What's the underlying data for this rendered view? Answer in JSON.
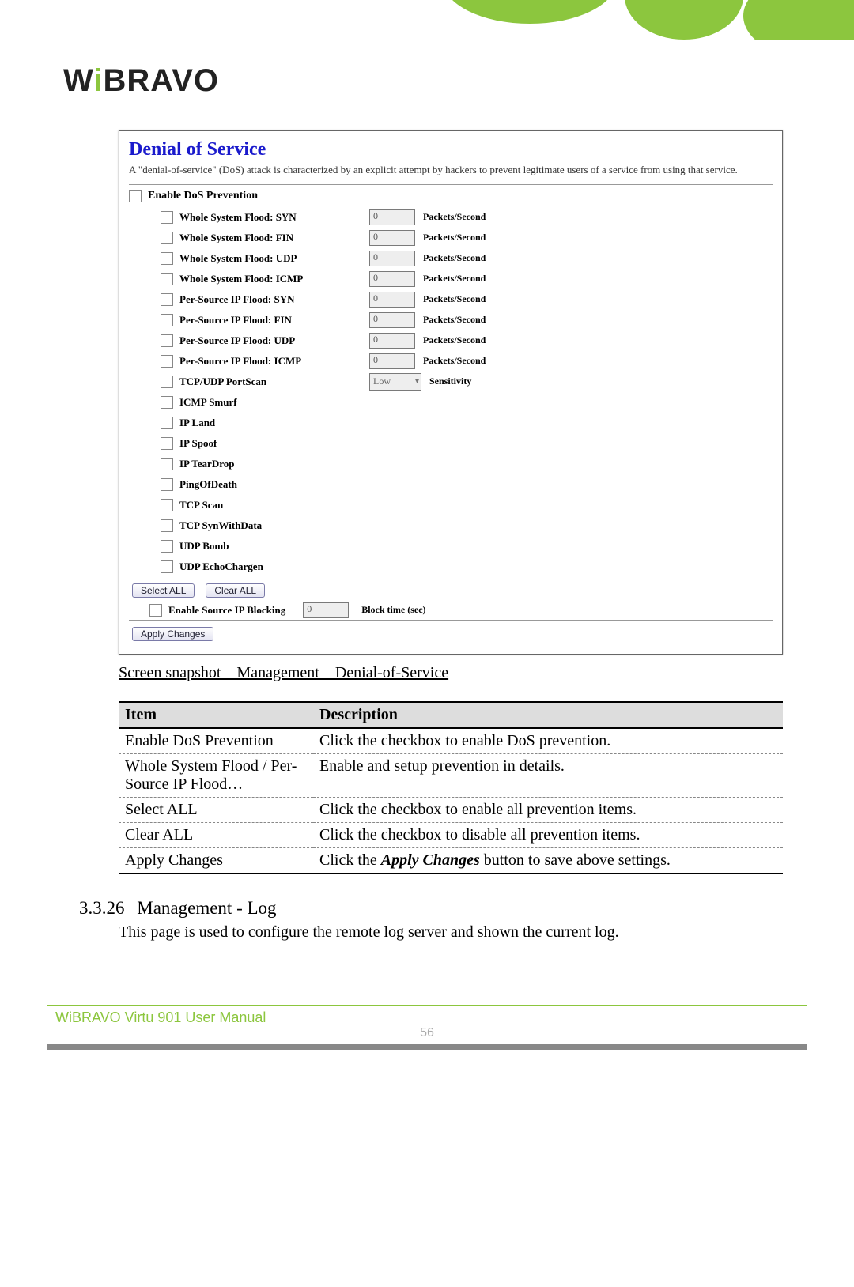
{
  "brand": "WiBRAVO",
  "shot": {
    "title": "Denial of Service",
    "desc": "A \"denial-of-service\" (DoS) attack is characterized by an explicit attempt by hackers to prevent legitimate users of a service from using that service.",
    "enable_label": "Enable DoS Prevention",
    "rows": [
      {
        "label": "Whole System Flood: SYN",
        "val": "0",
        "unit": "Packets/Second",
        "type": "num"
      },
      {
        "label": "Whole System Flood: FIN",
        "val": "0",
        "unit": "Packets/Second",
        "type": "num"
      },
      {
        "label": "Whole System Flood: UDP",
        "val": "0",
        "unit": "Packets/Second",
        "type": "num"
      },
      {
        "label": "Whole System Flood: ICMP",
        "val": "0",
        "unit": "Packets/Second",
        "type": "num"
      },
      {
        "label": "Per-Source IP Flood: SYN",
        "val": "0",
        "unit": "Packets/Second",
        "type": "num"
      },
      {
        "label": "Per-Source IP Flood: FIN",
        "val": "0",
        "unit": "Packets/Second",
        "type": "num"
      },
      {
        "label": "Per-Source IP Flood: UDP",
        "val": "0",
        "unit": "Packets/Second",
        "type": "num"
      },
      {
        "label": "Per-Source IP Flood: ICMP",
        "val": "0",
        "unit": "Packets/Second",
        "type": "num"
      },
      {
        "label": "TCP/UDP PortScan",
        "val": "Low",
        "unit": "Sensitivity",
        "type": "dd"
      },
      {
        "label": "ICMP Smurf",
        "type": "none"
      },
      {
        "label": "IP Land",
        "type": "none"
      },
      {
        "label": "IP Spoof",
        "type": "none"
      },
      {
        "label": "IP TearDrop",
        "type": "none"
      },
      {
        "label": "PingOfDeath",
        "type": "none"
      },
      {
        "label": "TCP Scan",
        "type": "none"
      },
      {
        "label": "TCP SynWithData",
        "type": "none"
      },
      {
        "label": "UDP Bomb",
        "type": "none"
      },
      {
        "label": "UDP EchoChargen",
        "type": "none"
      }
    ],
    "btn_select": "Select ALL",
    "btn_clear": "Clear ALL",
    "source_block_label": "Enable Source IP Blocking",
    "block_val": "0",
    "block_unit": "Block time (sec)",
    "btn_apply": "Apply Changes"
  },
  "caption": "Screen snapshot – Management – Denial-of-Service",
  "table": {
    "h1": "Item",
    "h2": "Description",
    "rows": [
      {
        "item": "Enable DoS Prevention",
        "desc": "Click the checkbox to enable DoS prevention."
      },
      {
        "item": "Whole System Flood / Per-Source IP Flood…",
        "desc": "Enable and setup prevention in details."
      },
      {
        "item": "Select ALL",
        "desc": "Click the checkbox to enable all prevention items."
      },
      {
        "item": "Clear ALL",
        "desc": "Click the checkbox to disable all prevention items."
      },
      {
        "item": "Apply Changes",
        "desc_pre": "Click the ",
        "desc_em": "Apply Changes",
        "desc_post": " button to save above settings."
      }
    ]
  },
  "section": {
    "num": "3.3.26",
    "title": "Management - Log",
    "body": "This page is used to configure the remote log server and shown the current log."
  },
  "footer": {
    "text": "WiBRAVO Virtu 901 User Manual",
    "page": "56"
  }
}
